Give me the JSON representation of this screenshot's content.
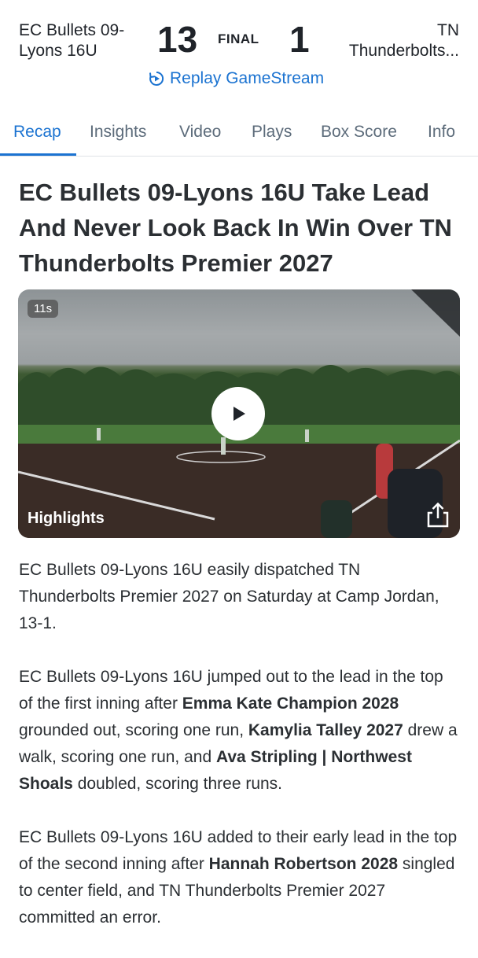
{
  "game": {
    "home_team_line1": "EC Bullets 09-",
    "home_team_line2": "Lyons 16U",
    "home_score": "13",
    "status": "FINAL",
    "away_score": "1",
    "away_team_line1": "TN",
    "away_team_line2": "Thunderbolts...",
    "replay_label": "Replay GameStream"
  },
  "tabs": [
    "Recap",
    "Insights",
    "Video",
    "Plays",
    "Box Score",
    "Info"
  ],
  "active_tab": "Recap",
  "headline": "EC Bullets 09-Lyons 16U Take Lead And Never Look Back In Win Over TN Thunderbolts Premier 2027",
  "video": {
    "duration": "11s",
    "label": "Highlights"
  },
  "article": {
    "p1": "EC Bullets 09-Lyons 16U easily dispatched TN Thunderbolts Premier 2027 on Saturday at Camp Jordan, 13-1.",
    "p2": {
      "t1": "EC Bullets 09-Lyons 16U jumped out to the lead in the top of the first inning after ",
      "b1": "Emma Kate Champion 2028",
      "t2": " grounded out, scoring one run, ",
      "b2": "Kamylia Talley 2027",
      "t3": " drew a walk, scoring one run, and ",
      "b3": "Ava Stripling | Northwest Shoals",
      "t4": " doubled, scoring three runs."
    },
    "p3": {
      "t1": "EC Bullets 09-Lyons 16U added to their early lead in the top of the second inning after ",
      "b1": "Hannah Robertson 2028",
      "t2": " singled to center field, and TN Thunderbolts Premier 2027 committed an error."
    }
  },
  "colors": {
    "accent": "#1b73d1",
    "tab_inactive": "#5c6b7a",
    "text": "#2b2f33"
  }
}
